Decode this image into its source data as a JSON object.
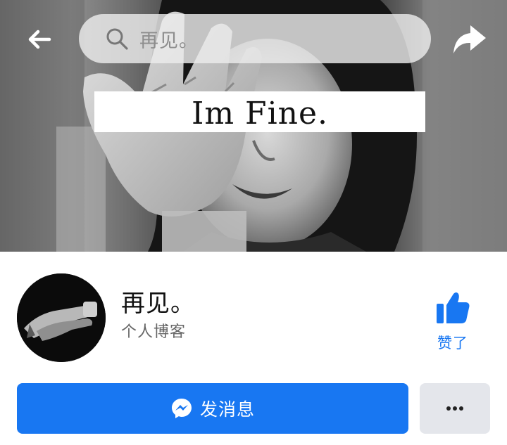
{
  "header": {
    "search": {
      "value": "再见。"
    }
  },
  "cover": {
    "caption": "Im Fine."
  },
  "profile": {
    "name": "再见。",
    "category": "个人博客",
    "like_label": "赞了"
  },
  "actions": {
    "message_label": "发消息"
  },
  "colors": {
    "accent": "#1877f2",
    "secondary_button": "#e4e6eb"
  },
  "icons": [
    "back-arrow-icon",
    "search-icon",
    "share-icon",
    "thumbs-up-icon",
    "messenger-icon",
    "more-dots-icon"
  ]
}
